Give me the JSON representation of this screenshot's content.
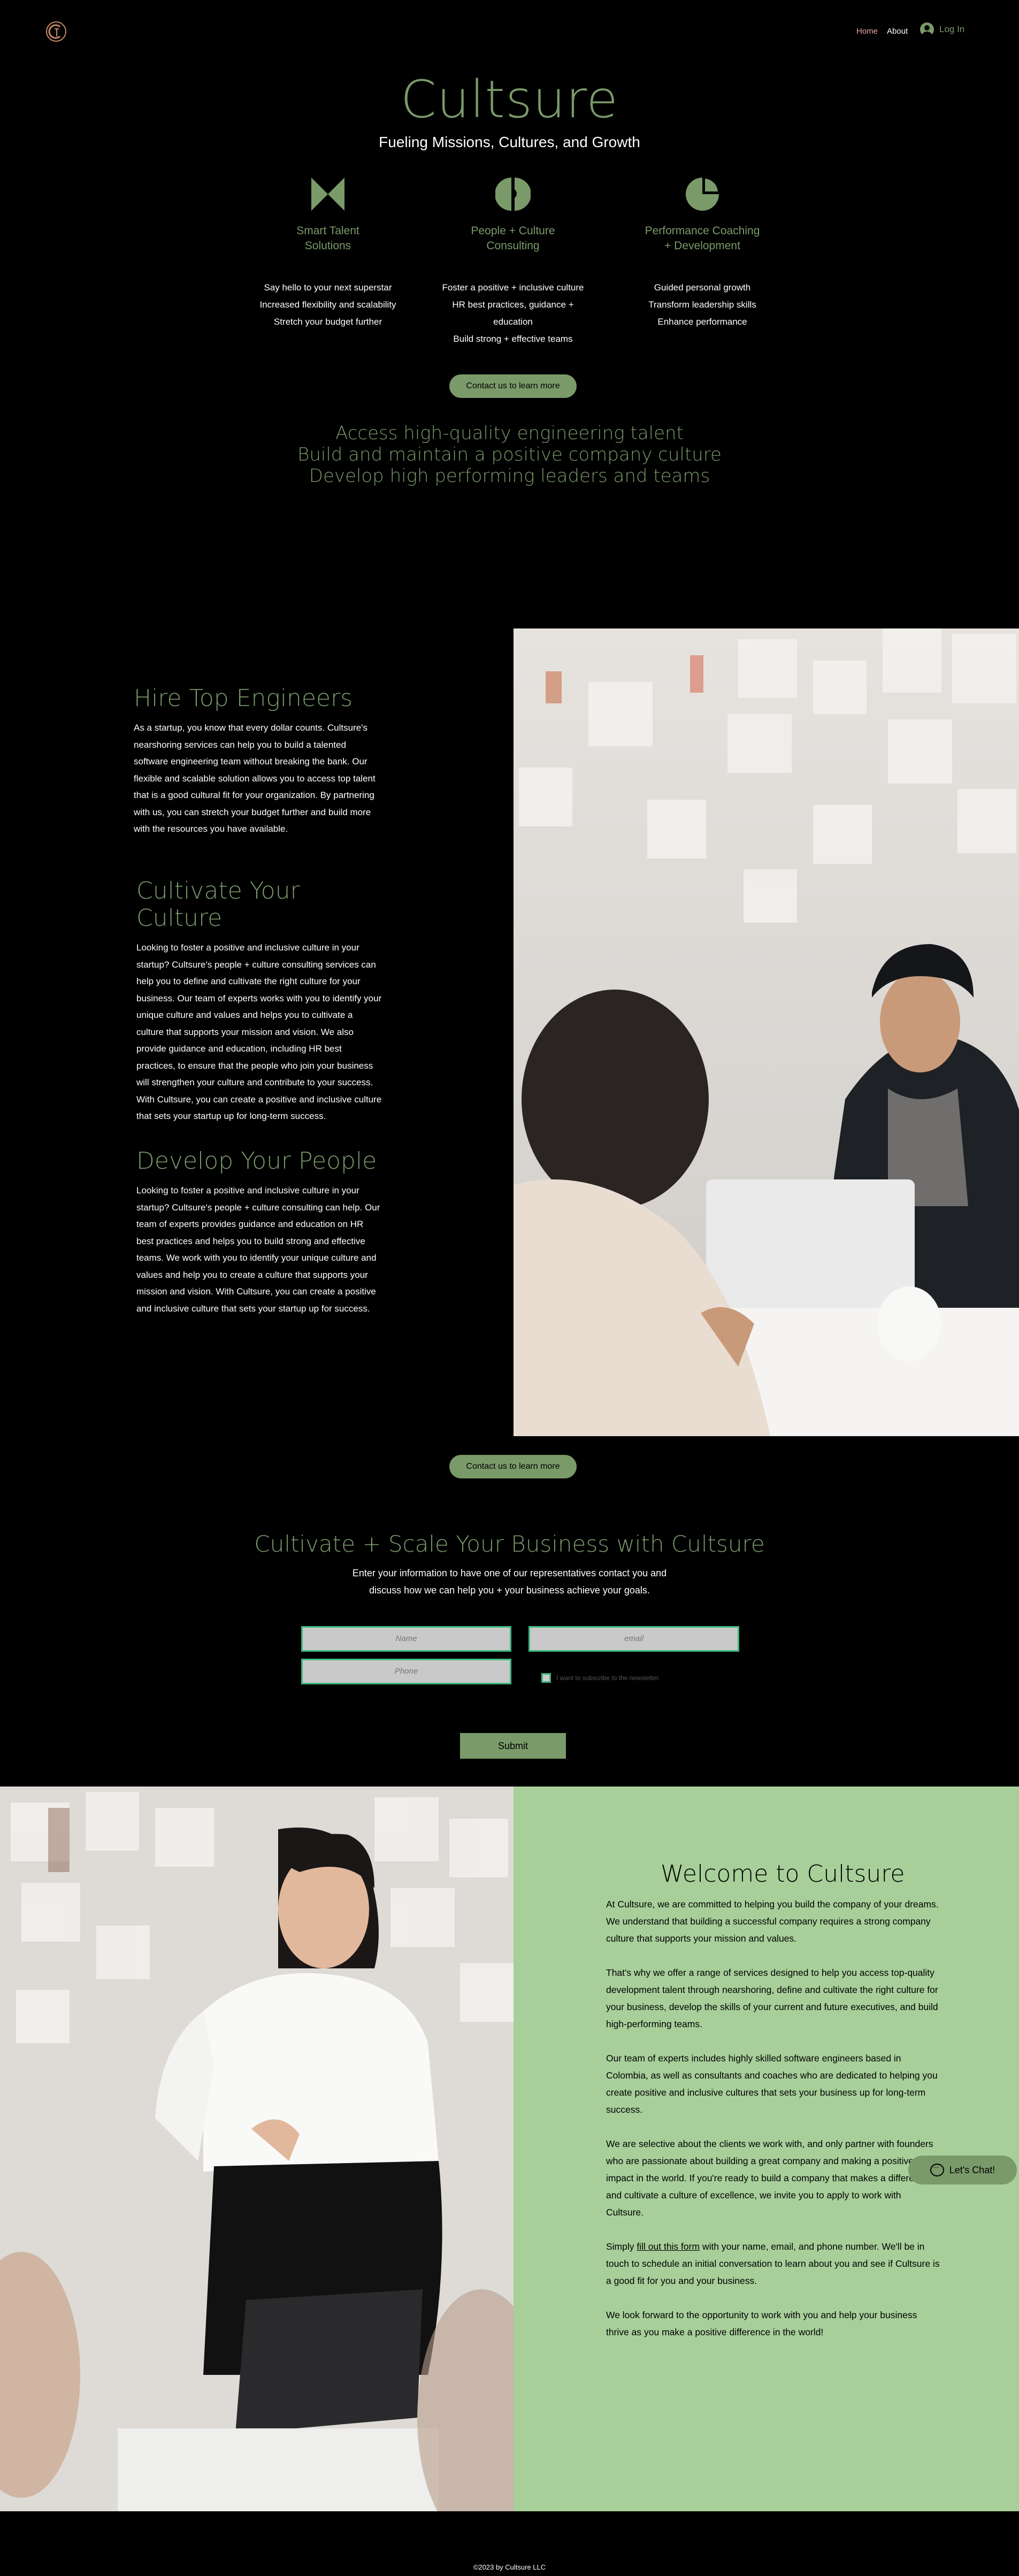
{
  "header": {
    "logo_icon": "cultsure-logo-icon",
    "nav": {
      "home": "Home",
      "about": "About"
    },
    "login_label": "Log In"
  },
  "hero": {
    "title": "Cultsure",
    "subtitle": "Fueling Missions, Cultures, and Growth"
  },
  "services": [
    {
      "icon": "bowtie-icon",
      "title_1": "Smart Talent",
      "title_2": "Solutions",
      "lines": [
        "Say hello to your next superstar",
        "Increased flexibility and scalability",
        "Stretch your budget further"
      ]
    },
    {
      "icon": "split-circle-icon",
      "title_1": "People + Culture",
      "title_2": "Consulting",
      "lines": [
        "Foster a positive + inclusive culture",
        "HR best practices, guidance + education",
        "Build strong + effective teams"
      ]
    },
    {
      "icon": "pie-icon",
      "title_1": "Performance Coaching",
      "title_2": "+ Development",
      "lines": [
        "Guided personal growth",
        "Transform leadership skills",
        "Enhance performance"
      ]
    }
  ],
  "cta_label": "Contact us to learn more",
  "access_lines": [
    "Access high-quality engineering talent",
    "Build and maintain a positive company culture",
    "Develop high performing leaders and teams"
  ],
  "features": [
    {
      "title": "Hire Top Engineers",
      "body": "As a startup, you know that every dollar counts. Cultsure's nearshoring services can help you to build a talented software engineering team without breaking the bank. Our flexible and scalable solution allows you to access top talent that is a good cultural fit for your organization. By partnering with us, you can stretch your budget further and build more with the resources you have available."
    },
    {
      "title": "Cultivate Your Culture",
      "body": "Looking to foster a positive and inclusive culture in your startup? Cultsure's people + culture consulting services can help you to define and cultivate the right culture for your business. Our team of experts works with you to identify your unique culture and values and helps you to cultivate a culture that supports your mission and vision. We also provide guidance and education, including HR best practices, to ensure that the people who join your business will strengthen your culture and contribute to your success. With Cultsure, you can create a positive and inclusive culture that sets your startup up for long-term success."
    },
    {
      "title": "Develop Your People",
      "body": "Looking to foster a positive and inclusive culture in your startup? Cultsure's people + culture consulting can help. Our team of experts provides guidance and education on HR best practices and helps you to build strong and effective teams. We work with you to identify your unique culture and values and help you to create a culture that supports your mission and vision. With Cultsure, you can create a positive and inclusive culture that sets your startup up for success."
    }
  ],
  "form": {
    "title": "Cultivate + Scale Your Business with Cultsure",
    "description": "Enter your information to have one of our representatives contact you and discuss how we can help you + your business achieve your goals.",
    "name_placeholder": "Name",
    "email_placeholder": "email",
    "phone_placeholder": "Phone",
    "newsletter_label": "I want to subscribe to the newsletter.",
    "submit_label": "Submit"
  },
  "welcome": {
    "title": "Welcome to Cultsure",
    "p1": "At Cultsure, we are committed to helping you build the company of your dreams. We understand that building a successful company requires a strong company culture that supports your mission and values.",
    "p2": "That's why we offer a range of services designed to help you access top-quality development talent through nearshoring, define and cultivate the right culture for your business, develop the skills of your current and future executives, and build high-performing teams.",
    "p3": "Our team of experts includes highly skilled software engineers based in Colombia, as well as consultants and coaches who are dedicated to helping you create positive and inclusive cultures that sets your business up for long-term success.",
    "p4": "We are selective about the clients we work with, and only partner with founders who are passionate about building a great company and making a positive impact in the world. If you're ready to build a company that makes a difference and cultivate a culture of excellence, we invite you to apply to work with Cultsure.",
    "p5_pre": "Simply ",
    "p5_link": "fill out this form",
    "p5_post": " with your name, email, and phone number. We'll be in touch to schedule an initial conversation to learn about you and see if Cultsure is a good fit for you and your business.",
    "p6": "We look forward to the opportunity to work with you and help your business thrive as you make a positive difference in the world!"
  },
  "chat_label": "Let's Chat!",
  "footer": "©2023 by Cultsure LLC",
  "colors": {
    "accent": "#7a9a6a",
    "panel": "#a8cf9a",
    "field_border": "#3fb880",
    "background": "#000000"
  }
}
